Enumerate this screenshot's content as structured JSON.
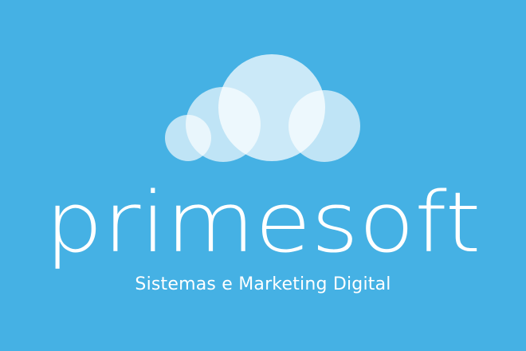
{
  "brand": {
    "name": "primesoft",
    "tagline": "Sistemas e Marketing Digital"
  },
  "colors": {
    "background": "#45b1e4",
    "text": "#ffffff",
    "cloud_fill": "#ffffff"
  },
  "icons": {
    "logo_mark": "cloud-icon"
  }
}
